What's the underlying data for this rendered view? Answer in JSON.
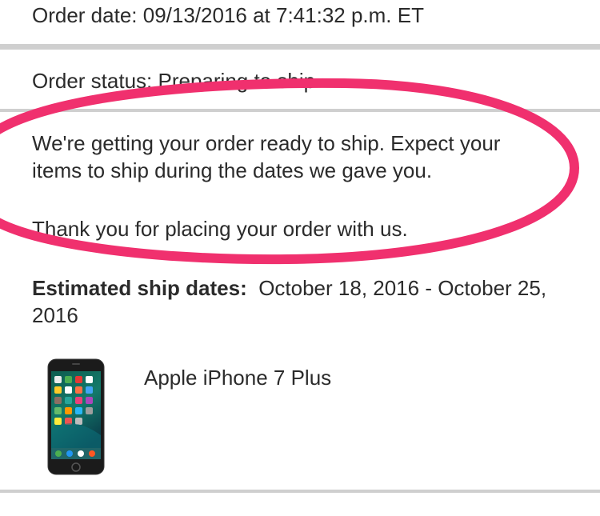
{
  "order": {
    "date_line": "Order date: 09/13/2016 at 7:41:32 p.m. ET",
    "status_line": "Order status: Preparing to ship"
  },
  "message": {
    "line1": "We're getting your order ready to ship. Expect your",
    "line2": "items to ship during the dates we gave you.",
    "thanks": "Thank you for placing your order with us."
  },
  "ship": {
    "label": "Estimated ship dates:",
    "dates_line1": "October 18, 2016 - October 25,",
    "dates_line2": "2016"
  },
  "product": {
    "name": "Apple iPhone 7 Plus",
    "image_icon": "iphone-icon"
  },
  "colors": {
    "annotation": "#f0306e",
    "divider": "#cfcfcf"
  }
}
